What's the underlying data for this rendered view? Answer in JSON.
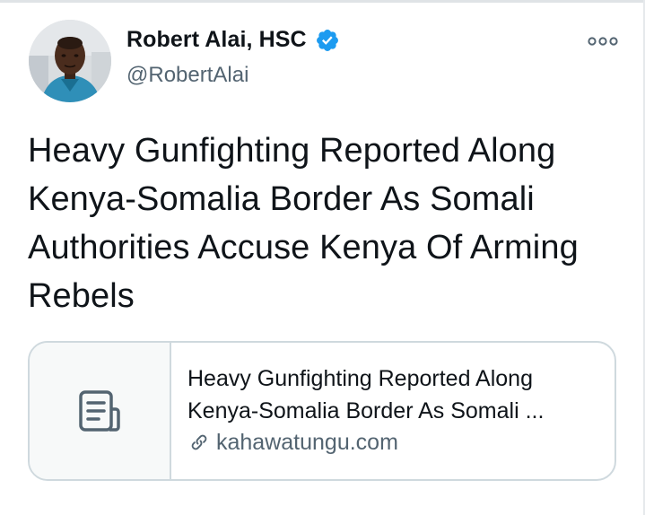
{
  "author": {
    "display_name": "Robert Alai, HSC",
    "handle": "@RobertAlai",
    "verified": true
  },
  "tweet": {
    "text": "Heavy Gunfighting Reported Along Kenya-Somalia Border As Somali Authorities Accuse Kenya Of Arming Rebels"
  },
  "link_card": {
    "title_line1": "Heavy Gunfighting Reported Along",
    "title_line2": "Kenya-Somalia Border As Somali ...",
    "domain": "kahawatungu.com",
    "thumbnail_icon": "document-icon"
  },
  "colors": {
    "text": "#0f1419",
    "secondary": "#536471",
    "verified_blue": "#1d9bf0",
    "border": "#cfd9de"
  },
  "icons": {
    "more": "more-horizontal-icon",
    "verified": "verified-badge-icon",
    "link": "link-icon"
  }
}
